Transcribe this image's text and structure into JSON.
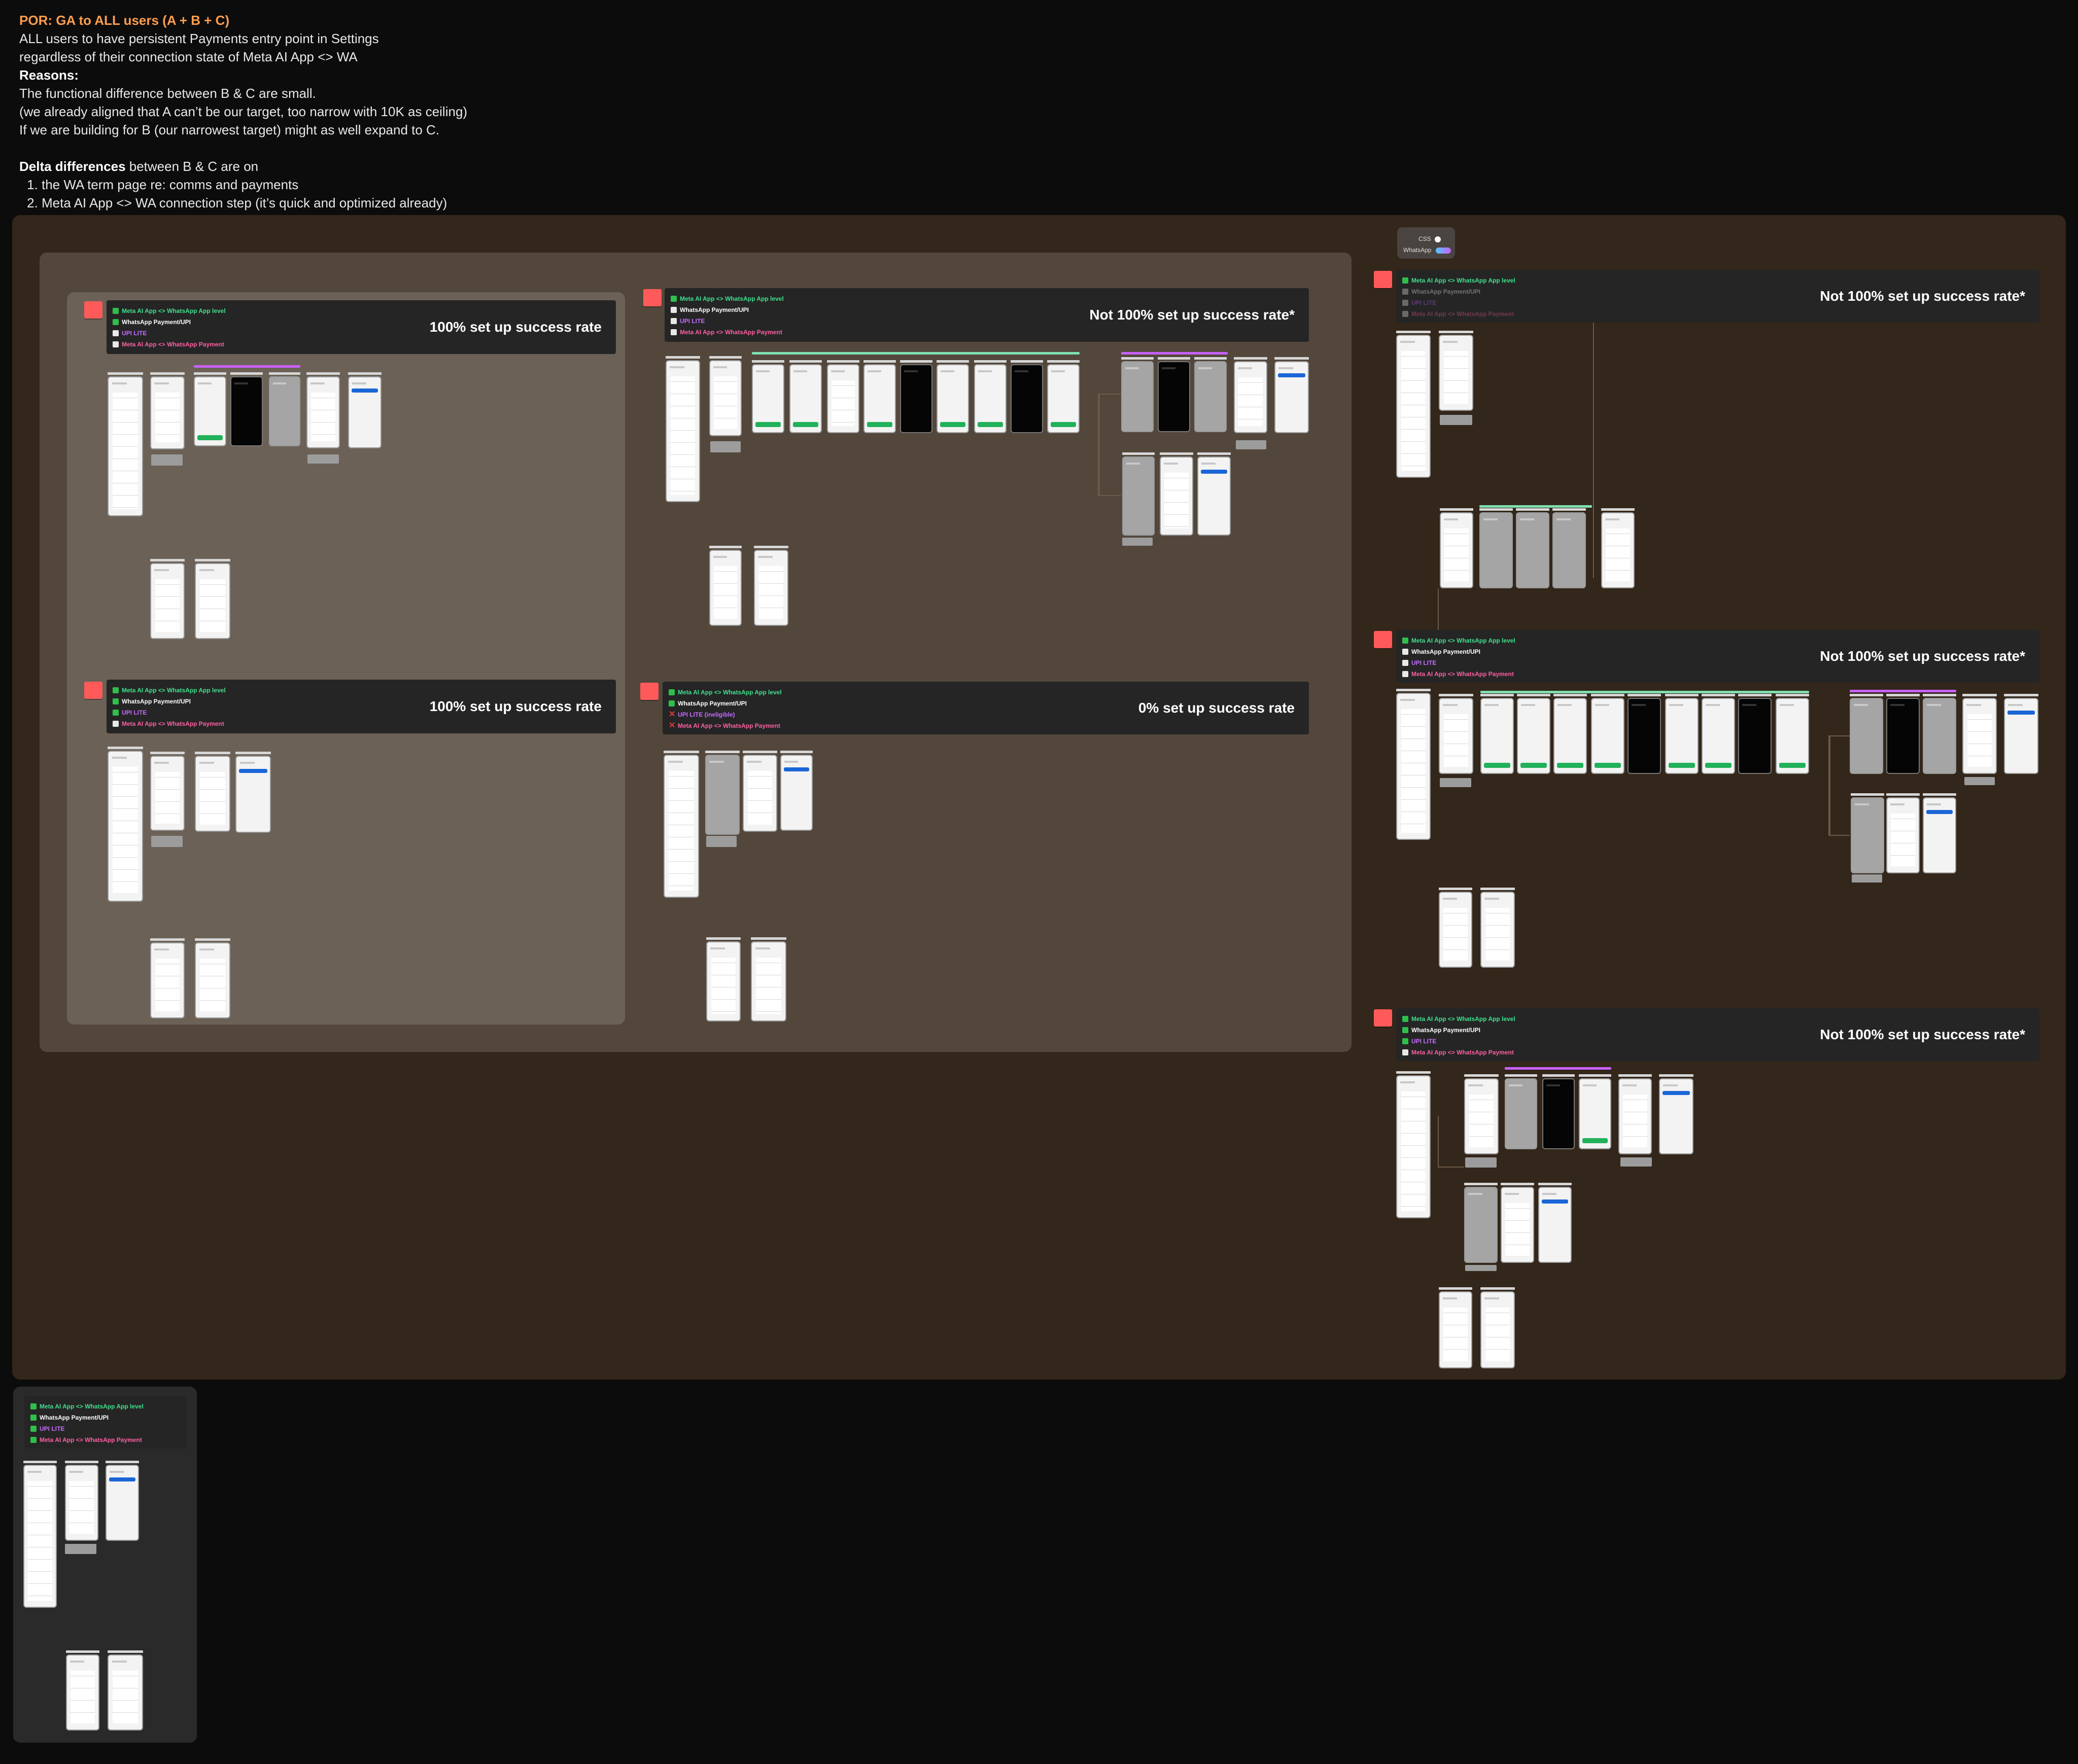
{
  "notes": {
    "heading": "POR: GA to ALL users (A + B + C)",
    "line1": "ALL users to have persistent Payments entry point in Settings",
    "line2": "regardless of their connection state of Meta AI App <> WA",
    "reasons_label": "Reasons:",
    "reason1": "The functional difference between B & C are small.",
    "reason2": "(we already aligned that A can’t be our target, too narrow with 10K as ceiling)",
    "reason3": "If we are building for B (our narrowest target) might as well expand to C.",
    "delta_label": "Delta differences",
    "delta_rest": " between B & C are on",
    "delta_items": [
      "the WA term page re: comms and payments",
      "Meta AI App <> WA connection step (it’s quick and optimized already)"
    ]
  },
  "criteria_labels": [
    "Meta AI App <> WhatsApp App level",
    "WhatsApp Payment/UPI",
    "UPI LITE",
    "Meta AI App <> WhatsApp Payment"
  ],
  "upi_lite_ineligible": "UPI LITE (ineligible)",
  "toggle_card": {
    "title": "CSS",
    "label": "WhatsApp",
    "colors": [
      "#53c7ff",
      "#c861ff"
    ]
  },
  "flows": [
    {
      "id": "flow-1",
      "rate": "100% set up success rate",
      "states": [
        "on",
        "on",
        "off",
        "off"
      ]
    },
    {
      "id": "flow-2",
      "rate": "100% set up success rate",
      "states": [
        "on",
        "on",
        "on",
        "off"
      ]
    },
    {
      "id": "flow-3",
      "rate": "Not 100% set up success rate*",
      "states": [
        "on",
        "off",
        "off",
        "off"
      ]
    },
    {
      "id": "flow-4",
      "rate": "0% set up success rate",
      "states": [
        "on",
        "on",
        "x",
        "x"
      ]
    },
    {
      "id": "flow-5",
      "rate": "Not 100% set up success rate*",
      "states": [
        "on",
        "off",
        "off",
        "off"
      ]
    },
    {
      "id": "flow-6",
      "rate": "Not 100% set up success rate*",
      "states": [
        "on",
        "off",
        "off",
        "off"
      ]
    },
    {
      "id": "flow-7",
      "rate": "Not 100% set up success rate*",
      "states": [
        "on",
        "on",
        "on",
        "off"
      ]
    },
    {
      "id": "flow-8",
      "rate": "",
      "states": [
        "on",
        "on",
        "on",
        "on"
      ]
    }
  ],
  "colors": {
    "heading": "#ff9d4d",
    "section_big": "#33261a",
    "section_inner": "#53473c",
    "section_left": "#6c6156",
    "check_on": "#2fbf4a",
    "criteria": [
      "#3fe08c",
      "#ffffff",
      "#c46bff",
      "#ff5fa2"
    ],
    "sticky": "#ff5a5a"
  }
}
